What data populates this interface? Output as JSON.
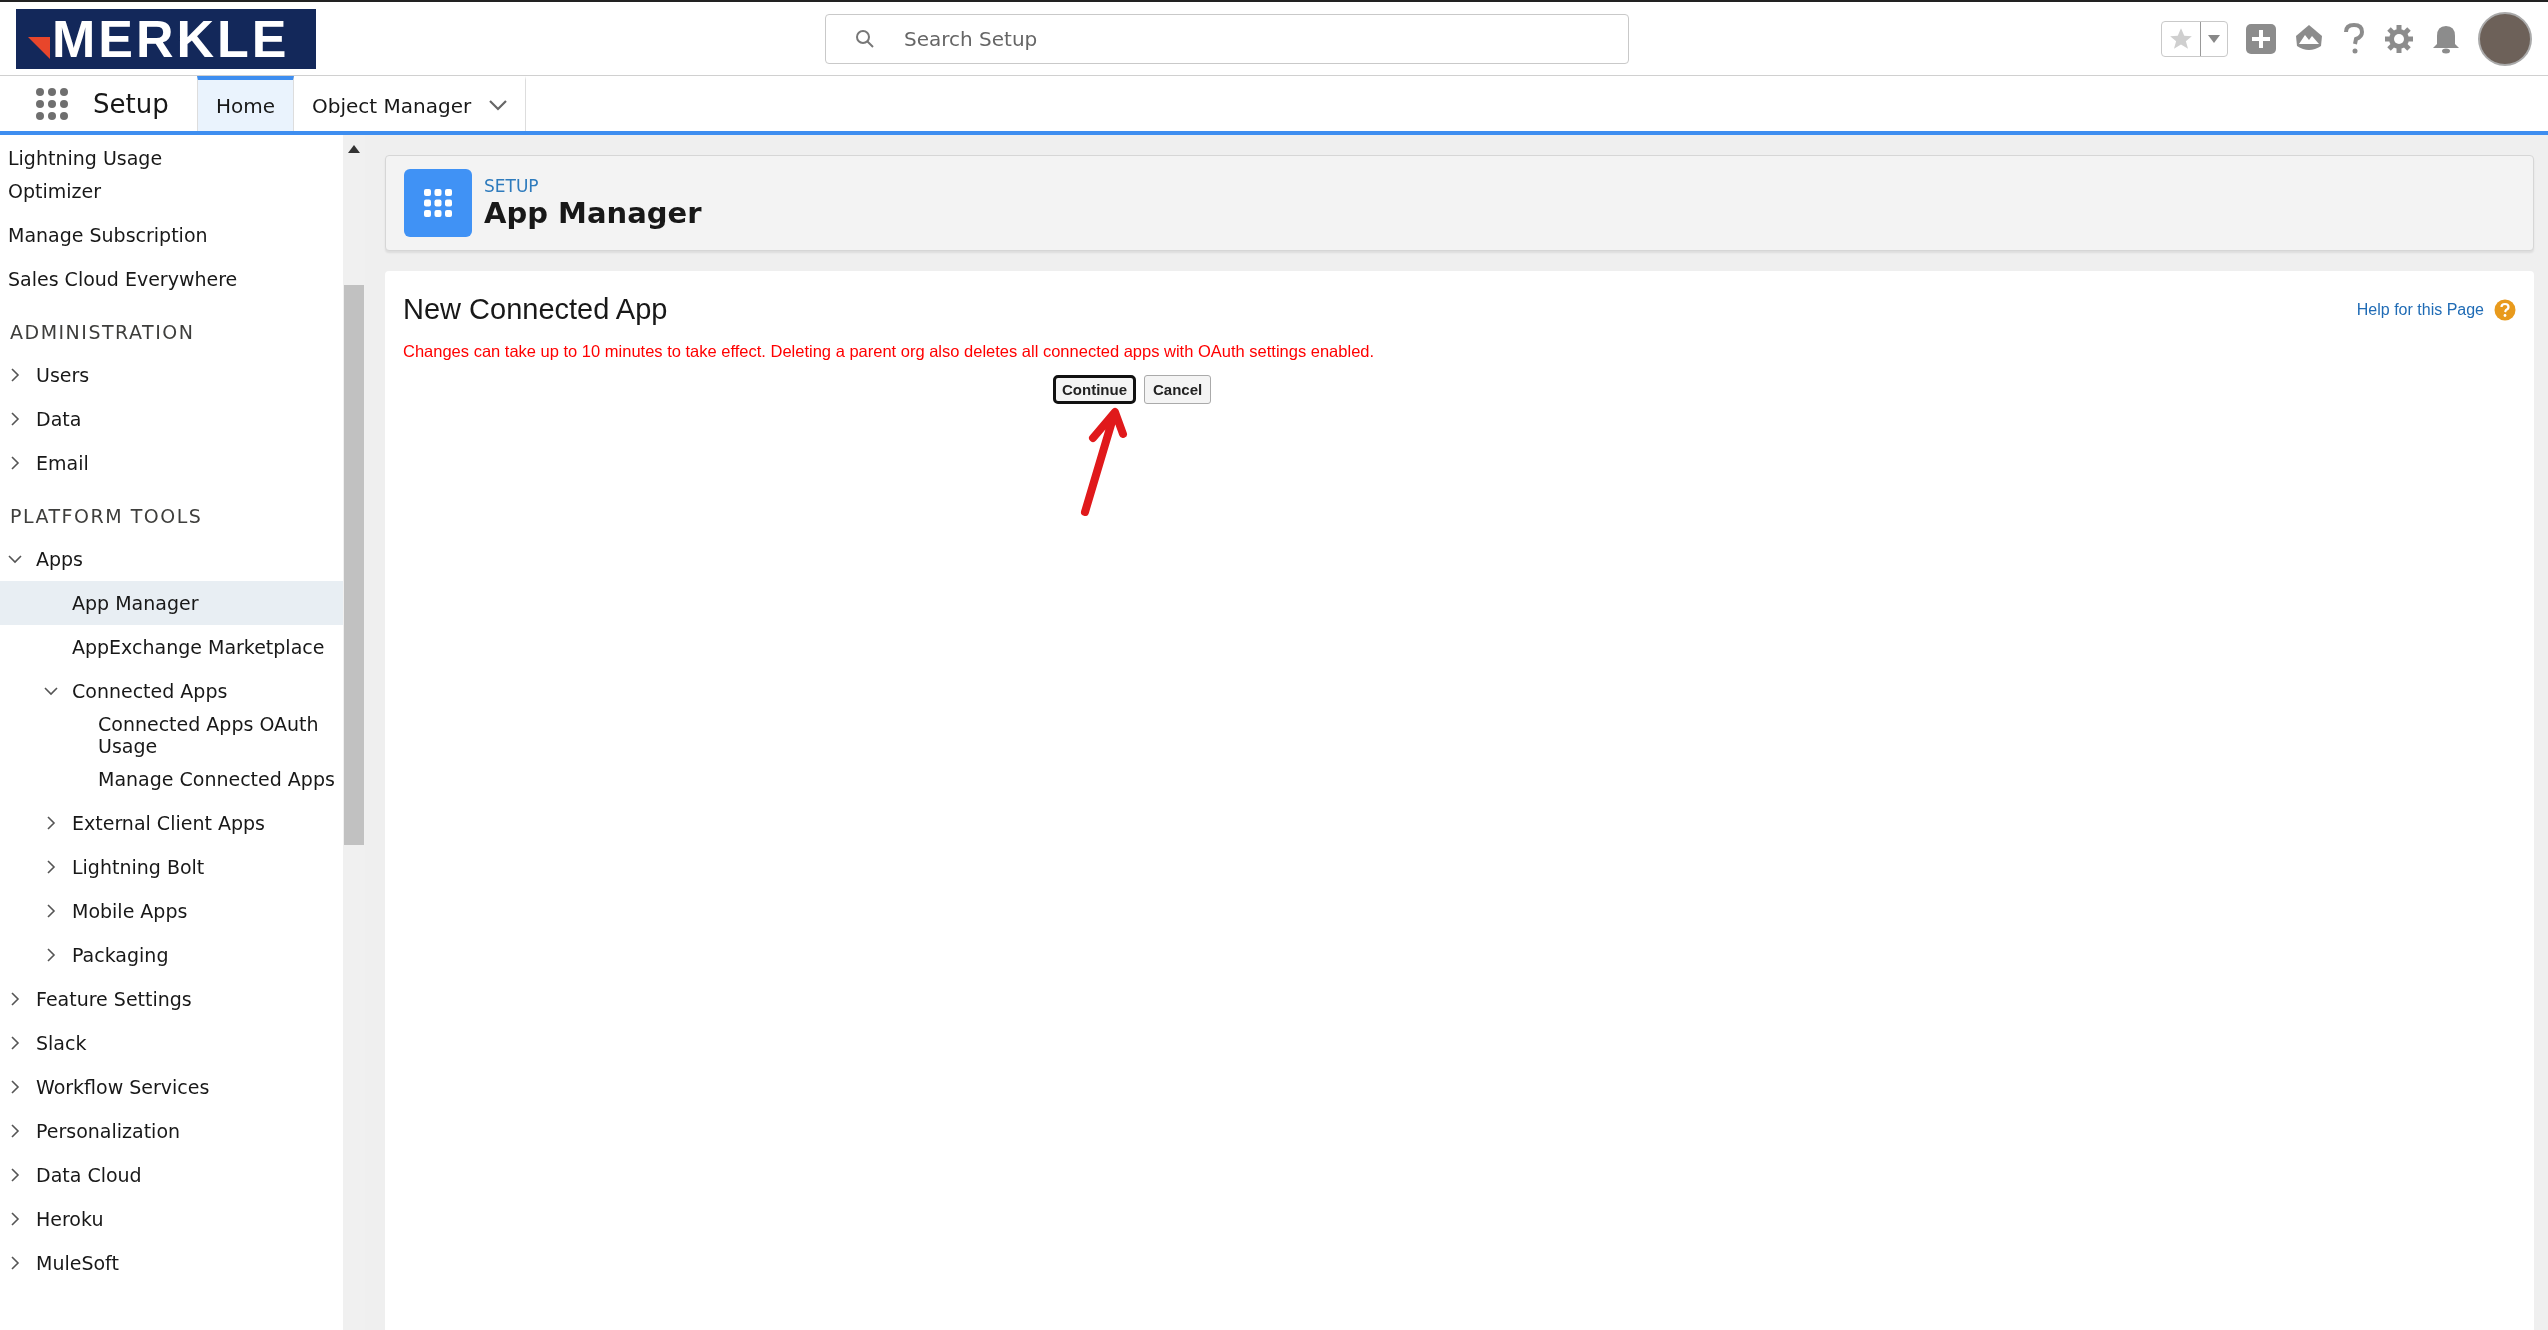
{
  "brand": {
    "logo": "MERKLE"
  },
  "search": {
    "placeholder": "Search Setup"
  },
  "nav": {
    "app_name": "Setup",
    "tabs": [
      {
        "label": "Home",
        "selected": true,
        "dropdown": false
      },
      {
        "label": "Object Manager",
        "selected": false,
        "dropdown": true
      }
    ]
  },
  "sidebar": {
    "groups": [
      {
        "items": [
          {
            "label": "Lightning Usage",
            "selected": false
          },
          {
            "label": "Optimizer",
            "selected": false
          },
          {
            "label": "Manage Subscription",
            "selected": false
          },
          {
            "label": "Sales Cloud Everywhere",
            "selected": false
          }
        ]
      },
      {
        "heading": "ADMINISTRATION",
        "items": [
          {
            "label": "Users",
            "selected": false,
            "expanded": false
          },
          {
            "label": "Data",
            "selected": false,
            "expanded": false
          },
          {
            "label": "Email",
            "selected": false,
            "expanded": false
          }
        ]
      },
      {
        "heading": "PLATFORM TOOLS",
        "items": [
          {
            "label": "Apps",
            "selected": false,
            "expanded": true,
            "children": [
              {
                "label": "App Manager",
                "selected": true
              },
              {
                "label": "AppExchange Marketplace",
                "selected": false
              },
              {
                "label": "Connected Apps",
                "selected": false,
                "expanded": true,
                "children": [
                  {
                    "label": "Connected Apps OAuth Usage",
                    "selected": false
                  },
                  {
                    "label": "Manage Connected Apps",
                    "selected": false
                  }
                ]
              },
              {
                "label": "External Client Apps",
                "selected": false,
                "expanded": false
              },
              {
                "label": "Lightning Bolt",
                "selected": false,
                "expanded": false
              },
              {
                "label": "Mobile Apps",
                "selected": false,
                "expanded": false
              },
              {
                "label": "Packaging",
                "selected": false,
                "expanded": false
              }
            ]
          },
          {
            "label": "Feature Settings",
            "selected": false,
            "expanded": false
          },
          {
            "label": "Slack",
            "selected": false,
            "expanded": false
          },
          {
            "label": "Workflow Services",
            "selected": false,
            "expanded": false
          },
          {
            "label": "Personalization",
            "selected": false,
            "expanded": false
          },
          {
            "label": "Data Cloud",
            "selected": false,
            "expanded": false
          },
          {
            "label": "Heroku",
            "selected": false,
            "expanded": false
          },
          {
            "label": "MuleSoft",
            "selected": false,
            "expanded": false
          }
        ]
      }
    ]
  },
  "page_header": {
    "eyebrow": "SETUP",
    "title": "App Manager"
  },
  "content": {
    "title": "New Connected App",
    "help_link": "Help for this Page",
    "warning": "Changes can take up to 10 minutes to take effect. Deleting a parent org also deletes all connected apps with OAuth settings enabled.",
    "buttons": [
      {
        "label": "Continue",
        "focused": true
      },
      {
        "label": "Cancel",
        "focused": false
      }
    ]
  }
}
